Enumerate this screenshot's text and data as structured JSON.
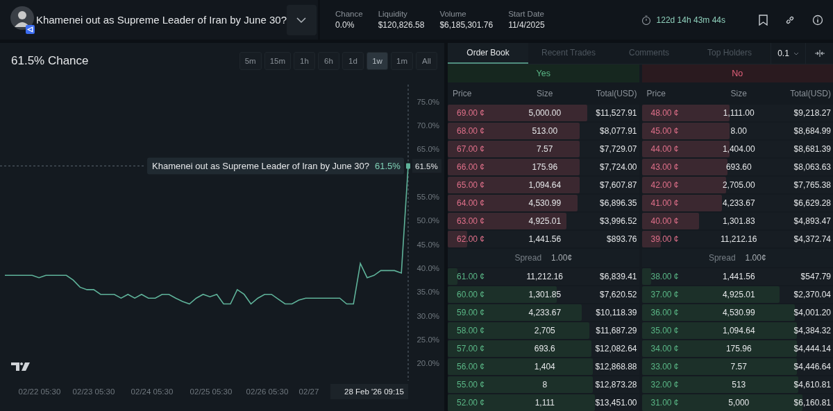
{
  "header": {
    "title": "Khamenei out as Supreme Leader of Iran by June 30?",
    "stats": [
      {
        "label": "Chance",
        "value": "0.0%"
      },
      {
        "label": "Liquidity",
        "value": "$120,826.58"
      },
      {
        "label": "Volume",
        "value": "$6,185,301.76"
      },
      {
        "label": "Start Date",
        "value": "11/4/2025"
      }
    ],
    "countdown": "122d 14h 43m 44s"
  },
  "chart_panel": {
    "heading": "61.5% Chance",
    "ranges": [
      {
        "label": "5m",
        "selected": false
      },
      {
        "label": "15m",
        "selected": false
      },
      {
        "label": "1h",
        "selected": false
      },
      {
        "label": "6h",
        "selected": false
      },
      {
        "label": "1d",
        "selected": false
      },
      {
        "label": "1w",
        "selected": true
      },
      {
        "label": "1m",
        "selected": false
      },
      {
        "label": "All",
        "selected": false
      }
    ],
    "chart_data": {
      "type": "line",
      "ylim": [
        16.4,
        78.6
      ],
      "ref_lines": [
        {
          "axis": "y",
          "value": 61.5
        }
      ],
      "yticks": [
        {
          "value": 20,
          "label": "20.0%"
        },
        {
          "value": 25,
          "label": "25.0%"
        },
        {
          "value": 30,
          "label": "30.0%"
        },
        {
          "value": 35,
          "label": "35.0%"
        },
        {
          "value": 40,
          "label": "40.0%"
        },
        {
          "value": 45,
          "label": "45.0%"
        },
        {
          "value": 50,
          "label": "50.0%"
        },
        {
          "value": 55,
          "label": "55.0%"
        },
        {
          "value": 65,
          "label": "65.0%"
        },
        {
          "value": 70,
          "label": "70.0%"
        },
        {
          "value": 75,
          "label": "75.0%"
        }
      ],
      "series": [
        {
          "name": "Khamenei out as Supreme Leader of Iran by June 30?",
          "color": "#5fb39a",
          "values": [
            38.5,
            38.5,
            38.5,
            38.5,
            38.5,
            38,
            38.5,
            38.5,
            38.5,
            38.5,
            37.5,
            36,
            35.5,
            35.5,
            34.5,
            34.5,
            34.5,
            33.7,
            34.5,
            33.7,
            34.5,
            33.7,
            33.7,
            34.5,
            34.5,
            33.7,
            33,
            32.5,
            33.7,
            34.5,
            34,
            34.5,
            32.5,
            32.5,
            35.5,
            34.5,
            32.5,
            33.7,
            34.5,
            34.5,
            33.5,
            32.5,
            32.5,
            33.3,
            33.7,
            33.7,
            33.7,
            33.7,
            33.7,
            33.7,
            32.5,
            32.5,
            41,
            38,
            38.5,
            39.5,
            39.5,
            39.5,
            39,
            61.5
          ]
        }
      ]
    },
    "tooltip": {
      "value": "61.5%"
    },
    "x_axis_labels": [
      "02/22 05:30",
      "02/23 05:30",
      "02/24 05:30",
      "02/25 05:30",
      "02/26 05:30",
      "02/27"
    ],
    "price_label": "61.5%",
    "crosshair_label": "28 Feb '26 09:15"
  },
  "order_book": {
    "tabs": [
      {
        "label": "Order Book",
        "selected": true
      },
      {
        "label": "Recent Trades",
        "selected": false
      },
      {
        "label": "Comments",
        "selected": false
      },
      {
        "label": "Top Holders",
        "selected": false
      }
    ],
    "increment": "0.1",
    "sides": [
      {
        "outcome": "Yes",
        "kind": "yes",
        "columns": [
          "Price",
          "Size",
          "Total(USD)"
        ],
        "asks": [
          {
            "price": "69.00 ¢",
            "size": "5,000.00",
            "total": "$11,527.91",
            "level": 0.73
          },
          {
            "price": "68.00 ¢",
            "size": "513.00",
            "total": "$8,077.91",
            "level": 0.69
          },
          {
            "price": "67.00 ¢",
            "size": "7.57",
            "total": "$7,729.07",
            "level": 0.69
          },
          {
            "price": "66.00 ¢",
            "size": "175.96",
            "total": "$7,724.00",
            "level": 0.69
          },
          {
            "price": "65.00 ¢",
            "size": "1,094.64",
            "total": "$7,607.87",
            "level": 0.69
          },
          {
            "price": "64.00 ¢",
            "size": "4,530.99",
            "total": "$6,896.35",
            "level": 0.68
          },
          {
            "price": "63.00 ¢",
            "size": "4,925.01",
            "total": "$3,996.52",
            "level": 0.62
          },
          {
            "price": "62.00 ¢",
            "size": "1,441.56",
            "total": "$893.76",
            "level": 0.1
          }
        ],
        "spread_label": "Spread",
        "spread": "1.00¢",
        "bids": [
          {
            "price": "61.00 ¢",
            "size": "11,212.16",
            "total": "$6,839.41",
            "level": 0.05
          },
          {
            "price": "60.00 ¢",
            "size": "1,301.85",
            "total": "$7,620.52",
            "level": 0.57
          },
          {
            "price": "59.00 ¢",
            "size": "4,233.67",
            "total": "$10,118.39",
            "level": 0.7
          },
          {
            "price": "58.00 ¢",
            "size": "2,705",
            "total": "$11,687.29",
            "level": 0.74
          },
          {
            "price": "57.00 ¢",
            "size": "693.6",
            "total": "$12,082.64",
            "level": 0.75
          },
          {
            "price": "56.00 ¢",
            "size": "1,404",
            "total": "$12,868.88",
            "level": 0.76
          },
          {
            "price": "55.00 ¢",
            "size": "8",
            "total": "$12,873.28",
            "level": 0.76
          },
          {
            "price": "52.00 ¢",
            "size": "1,111",
            "total": "$13,451.00",
            "level": 0.77
          }
        ]
      },
      {
        "outcome": "No",
        "kind": "no",
        "columns": [
          "Price",
          "Size",
          "Total(USD)"
        ],
        "asks": [
          {
            "price": "48.00 ¢",
            "size": "1,111.00",
            "total": "$9,218.27",
            "level": 0.46
          },
          {
            "price": "45.00 ¢",
            "size": "8.00",
            "total": "$8,684.99",
            "level": 0.46
          },
          {
            "price": "44.00 ¢",
            "size": "1,404.00",
            "total": "$8,681.39",
            "level": 0.46
          },
          {
            "price": "43.00 ¢",
            "size": "693.60",
            "total": "$8,063.63",
            "level": 0.45
          },
          {
            "price": "42.00 ¢",
            "size": "2,705.00",
            "total": "$7,765.38",
            "level": 0.44
          },
          {
            "price": "41.00 ¢",
            "size": "4,233.67",
            "total": "$6,629.28",
            "level": 0.42
          },
          {
            "price": "40.00 ¢",
            "size": "1,301.83",
            "total": "$4,893.47",
            "level": 0.3
          },
          {
            "price": "39.00 ¢",
            "size": "11,212.16",
            "total": "$4,372.74",
            "level": 0.1
          }
        ],
        "spread_label": "Spread",
        "spread": "1.00¢",
        "bids": [
          {
            "price": "38.00 ¢",
            "size": "1,441.56",
            "total": "$547.79",
            "level": 0.05
          },
          {
            "price": "37.00 ¢",
            "size": "4,925.01",
            "total": "$2,370.04",
            "level": 0.72
          },
          {
            "price": "36.00 ¢",
            "size": "4,530.99",
            "total": "$4,001.20",
            "level": 0.8
          },
          {
            "price": "35.00 ¢",
            "size": "1,094.64",
            "total": "$4,384.32",
            "level": 0.81
          },
          {
            "price": "34.00 ¢",
            "size": "175.96",
            "total": "$4,444.14",
            "level": 0.81
          },
          {
            "price": "33.00 ¢",
            "size": "7.57",
            "total": "$4,446.64",
            "level": 0.81
          },
          {
            "price": "32.00 ¢",
            "size": "513",
            "total": "$4,610.81",
            "level": 0.82
          },
          {
            "price": "31.00 ¢",
            "size": "5,000",
            "total": "$6,160.81",
            "level": 0.84
          }
        ]
      }
    ]
  }
}
